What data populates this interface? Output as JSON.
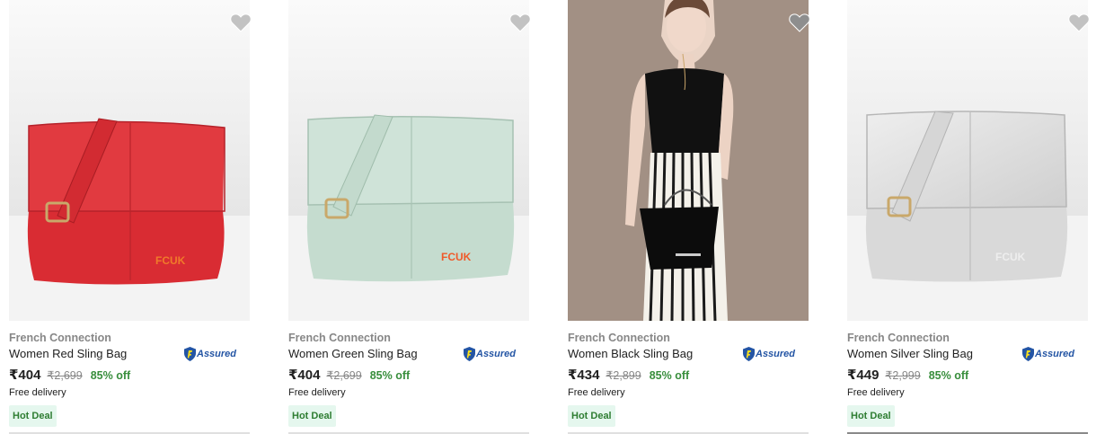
{
  "colors": {
    "brand_text": "#878787",
    "price_off": "#388e3c",
    "assured_blue": "#2455a4",
    "deal_bg": "#e5f7ee",
    "deal_text": "#2e7d32",
    "heart": "#c2c2c2"
  },
  "products": [
    {
      "brand": "French Connection",
      "title": "Women Red Sling Bag",
      "price": "₹404",
      "mrp": "₹2,699",
      "discount": "85% off",
      "delivery": "Free delivery",
      "badge": "Hot Deal",
      "assured": "Assured",
      "image_icon": "red-sling-bag-image",
      "logo_text": "FCUK"
    },
    {
      "brand": "French Connection",
      "title": "Women Green Sling Bag",
      "price": "₹404",
      "mrp": "₹2,699",
      "discount": "85% off",
      "delivery": "Free delivery",
      "badge": "Hot Deal",
      "assured": "Assured",
      "image_icon": "green-sling-bag-image",
      "logo_text": "FCUK"
    },
    {
      "brand": "French Connection",
      "title": "Women Black Sling Bag",
      "price": "₹434",
      "mrp": "₹2,899",
      "discount": "85% off",
      "delivery": "Free delivery",
      "badge": "Hot Deal",
      "assured": "Assured",
      "image_icon": "model-with-black-bag-image"
    },
    {
      "brand": "French Connection",
      "title": "Women Silver Sling Bag",
      "price": "₹449",
      "mrp": "₹2,999",
      "discount": "85% off",
      "delivery": "Free delivery",
      "badge": "Hot Deal",
      "assured": "Assured",
      "image_icon": "silver-sling-bag-image",
      "logo_text": "FCUK"
    }
  ]
}
